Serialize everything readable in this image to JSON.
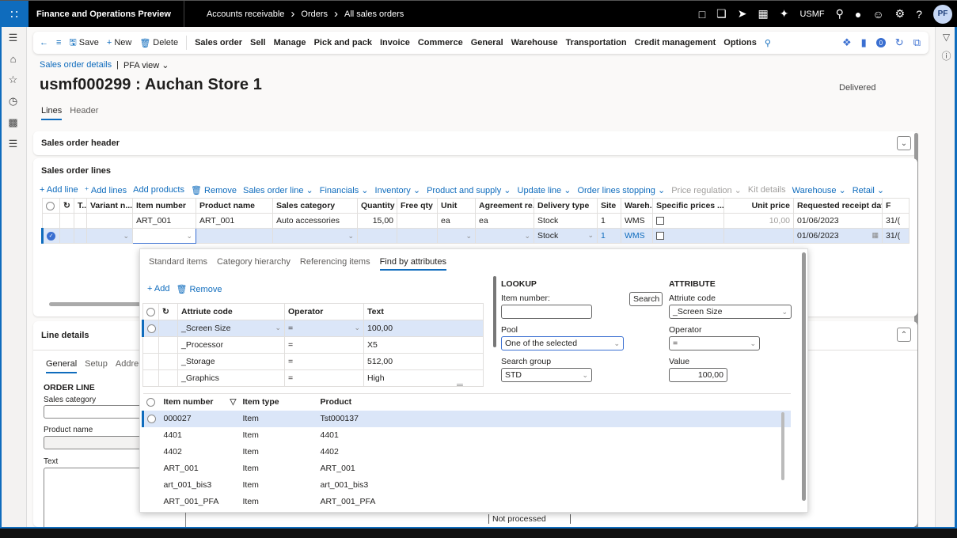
{
  "topbar": {
    "app_title": "Finance and Operations Preview",
    "breadcrumbs": [
      "Accounts receivable",
      "Orders",
      "All sales orders"
    ],
    "company": "USMF",
    "user_initials": "PF"
  },
  "actionbar": {
    "save": "Save",
    "new": "New",
    "delete": "Delete",
    "menus": [
      "Sales order",
      "Sell",
      "Manage",
      "Pick and pack",
      "Invoice",
      "Commerce",
      "General",
      "Warehouse",
      "Transportation",
      "Credit management",
      "Options"
    ],
    "notification_count": "0"
  },
  "page": {
    "breadcrumb_link": "Sales order details",
    "view_name": "PFA view",
    "title": "usmf000299 : Auchan Store 1",
    "status": "Delivered",
    "tabs": [
      "Lines",
      "Header"
    ]
  },
  "header_card": {
    "title": "Sales order header"
  },
  "lines_card": {
    "title": "Sales order lines",
    "toolbar": [
      {
        "label": "Add line",
        "enabled": true
      },
      {
        "label": "Add lines",
        "enabled": true
      },
      {
        "label": "Add products",
        "enabled": true
      },
      {
        "label": "Remove",
        "enabled": true
      },
      {
        "label": "Sales order line",
        "enabled": true
      },
      {
        "label": "Financials",
        "enabled": true
      },
      {
        "label": "Inventory",
        "enabled": true
      },
      {
        "label": "Product and supply",
        "enabled": true
      },
      {
        "label": "Update line",
        "enabled": true
      },
      {
        "label": "Order lines stopping",
        "enabled": true
      },
      {
        "label": "Price regulation",
        "enabled": false
      },
      {
        "label": "Kit details",
        "enabled": false
      },
      {
        "label": "Warehouse",
        "enabled": true
      },
      {
        "label": "Retail",
        "enabled": true
      }
    ],
    "columns": [
      "T...",
      "Variant n...",
      "Item number",
      "Product name",
      "Sales category",
      "Quantity",
      "Free qty",
      "Unit",
      "Agreement re...",
      "Delivery type",
      "Site",
      "Wareh...",
      "Specific prices ...",
      "Unit price",
      "Requested receipt date",
      "F"
    ],
    "rows": [
      {
        "item": "ART_001",
        "product": "ART_001",
        "category": "Auto accessories",
        "qty": "15,00",
        "free": "",
        "unit": "ea",
        "agreement": "ea",
        "delivery": "Stock",
        "site": "1",
        "warehouse": "WMS",
        "price": "10,00",
        "date": "01/06/2023",
        "f": "31/("
      },
      {
        "item": "",
        "product": "",
        "category": "",
        "qty": "",
        "free": "",
        "unit": "",
        "agreement": "",
        "delivery": "Stock",
        "site": "1",
        "warehouse": "WMS",
        "price": "",
        "date": "01/06/2023",
        "f": "31/("
      }
    ]
  },
  "line_details": {
    "title": "Line details",
    "tabs": [
      "General",
      "Setup",
      "Addre"
    ],
    "section": "ORDER LINE",
    "fields": [
      "Sales category",
      "Product name",
      "Text"
    ],
    "status_value": "Not processed"
  },
  "popup": {
    "tabs": [
      "Standard items",
      "Category hierarchy",
      "Referencing items",
      "Find by attributes"
    ],
    "active_tab": "Find by attributes",
    "add": "Add",
    "remove": "Remove",
    "attr_columns": [
      "Attriute code",
      "Operator",
      "Text"
    ],
    "attr_rows": [
      {
        "code": "_Screen Size",
        "op": "=",
        "text": "100,00"
      },
      {
        "code": "_Processor",
        "op": "=",
        "text": "X5"
      },
      {
        "code": "_Storage",
        "op": "=",
        "text": "512,00"
      },
      {
        "code": "_Graphics",
        "op": "=",
        "text": "High"
      }
    ],
    "lookup": {
      "heading": "LOOKUP",
      "item_number_label": "Item number:",
      "item_number_value": "",
      "search_button": "Search",
      "pool_label": "Pool",
      "pool_value": "One of the selected",
      "search_group_label": "Search group",
      "search_group_value": "STD"
    },
    "attribute": {
      "heading": "ATTRIBUTE",
      "code_label": "Attriute code",
      "code_value": "_Screen Size",
      "operator_label": "Operator",
      "operator_value": "=",
      "value_label": "Value",
      "value_value": "100,00"
    },
    "result_columns": [
      "Item number",
      "Item type",
      "Product"
    ],
    "results": [
      {
        "item": "000027",
        "type": "Item",
        "product": "Tst000137"
      },
      {
        "item": "4401",
        "type": "Item",
        "product": "4401"
      },
      {
        "item": "4402",
        "type": "Item",
        "product": "4402"
      },
      {
        "item": "ART_001",
        "type": "Item",
        "product": "ART_001"
      },
      {
        "item": "art_001_bis3",
        "type": "Item",
        "product": "art_001_bis3"
      },
      {
        "item": "ART_001_PFA",
        "type": "Item",
        "product": "ART_001_PFA"
      }
    ]
  }
}
